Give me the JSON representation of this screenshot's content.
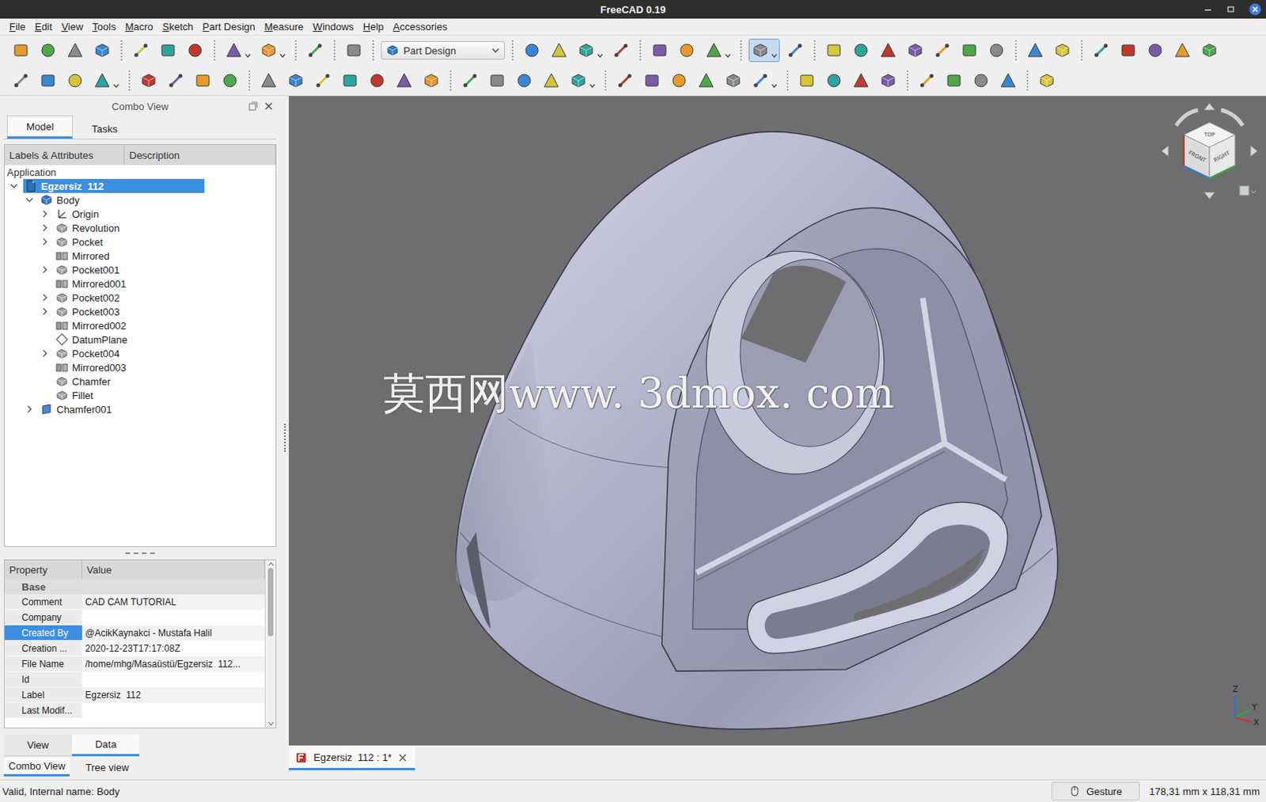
{
  "window": {
    "title": "FreeCAD 0.19"
  },
  "menu": [
    "File",
    "Edit",
    "View",
    "Tools",
    "Macro",
    "Sketch",
    "Part Design",
    "Measure",
    "Windows",
    "Help",
    "Accessories"
  ],
  "toolbars": [
    [
      {
        "kind": "button",
        "pressed": false,
        "dropdown": false
      },
      {
        "kind": "button",
        "pressed": false,
        "dropdown": false
      },
      {
        "kind": "button",
        "pressed": false,
        "dropdown": false
      },
      {
        "kind": "button",
        "pressed": false,
        "dropdown": false
      },
      {
        "kind": "separator"
      },
      {
        "kind": "button",
        "pressed": false,
        "dropdown": false
      },
      {
        "kind": "button",
        "pressed": false,
        "dropdown": false
      },
      {
        "kind": "button",
        "pressed": false,
        "dropdown": false
      },
      {
        "kind": "separator"
      },
      {
        "kind": "button",
        "pressed": false,
        "dropdown": true
      },
      {
        "kind": "button",
        "pressed": false,
        "dropdown": true
      },
      {
        "kind": "separator"
      },
      {
        "kind": "button",
        "pressed": false,
        "dropdown": false
      },
      {
        "kind": "separator"
      },
      {
        "kind": "button",
        "pressed": false,
        "dropdown": false
      },
      {
        "kind": "separator"
      },
      {
        "kind": "combo",
        "label": "Part Design"
      },
      {
        "kind": "separator"
      },
      {
        "kind": "button",
        "pressed": false,
        "dropdown": false
      },
      {
        "kind": "button",
        "pressed": false,
        "dropdown": false
      },
      {
        "kind": "button",
        "pressed": false,
        "dropdown": true
      },
      {
        "kind": "button",
        "pressed": false,
        "dropdown": false
      },
      {
        "kind": "separator"
      },
      {
        "kind": "button",
        "pressed": false,
        "dropdown": false
      },
      {
        "kind": "button",
        "pressed": false,
        "dropdown": false
      },
      {
        "kind": "button",
        "pressed": false,
        "dropdown": true
      },
      {
        "kind": "separator"
      },
      {
        "kind": "button",
        "pressed": true,
        "dropdown": true
      },
      {
        "kind": "button",
        "pressed": false,
        "dropdown": false
      },
      {
        "kind": "separator"
      },
      {
        "kind": "button",
        "pressed": false,
        "dropdown": false
      },
      {
        "kind": "button",
        "pressed": false,
        "dropdown": false
      },
      {
        "kind": "button",
        "pressed": false,
        "dropdown": false
      },
      {
        "kind": "button",
        "pressed": false,
        "dropdown": false
      },
      {
        "kind": "button",
        "pressed": false,
        "dropdown": false
      },
      {
        "kind": "button",
        "pressed": false,
        "dropdown": false
      },
      {
        "kind": "button",
        "pressed": false,
        "dropdown": false
      },
      {
        "kind": "separator"
      },
      {
        "kind": "button",
        "pressed": false,
        "dropdown": false
      },
      {
        "kind": "button",
        "pressed": false,
        "dropdown": false
      },
      {
        "kind": "separator"
      },
      {
        "kind": "button",
        "pressed": false,
        "dropdown": false
      },
      {
        "kind": "button",
        "pressed": false,
        "dropdown": false
      },
      {
        "kind": "button",
        "pressed": false,
        "dropdown": false
      },
      {
        "kind": "button",
        "pressed": false,
        "dropdown": false
      },
      {
        "kind": "button",
        "pressed": false,
        "dropdown": false
      }
    ],
    [
      {
        "kind": "button",
        "pressed": false,
        "dropdown": false
      },
      {
        "kind": "button",
        "pressed": false,
        "dropdown": false
      },
      {
        "kind": "button",
        "pressed": false,
        "dropdown": false
      },
      {
        "kind": "button",
        "pressed": false,
        "dropdown": true
      },
      {
        "kind": "separator"
      },
      {
        "kind": "button",
        "pressed": false,
        "dropdown": false
      },
      {
        "kind": "button",
        "pressed": false,
        "dropdown": false
      },
      {
        "kind": "button",
        "pressed": false,
        "dropdown": false
      },
      {
        "kind": "button",
        "pressed": false,
        "dropdown": false
      },
      {
        "kind": "separator"
      },
      {
        "kind": "button",
        "pressed": false,
        "dropdown": false
      },
      {
        "kind": "button",
        "pressed": false,
        "dropdown": false
      },
      {
        "kind": "button",
        "pressed": false,
        "dropdown": false
      },
      {
        "kind": "button",
        "pressed": false,
        "dropdown": false
      },
      {
        "kind": "button",
        "pressed": false,
        "dropdown": false
      },
      {
        "kind": "button",
        "pressed": false,
        "dropdown": false
      },
      {
        "kind": "button",
        "pressed": false,
        "dropdown": false
      },
      {
        "kind": "separator"
      },
      {
        "kind": "button",
        "pressed": false,
        "dropdown": false
      },
      {
        "kind": "button",
        "pressed": false,
        "dropdown": false
      },
      {
        "kind": "button",
        "pressed": false,
        "dropdown": false
      },
      {
        "kind": "button",
        "pressed": false,
        "dropdown": false
      },
      {
        "kind": "button",
        "pressed": false,
        "dropdown": true
      },
      {
        "kind": "separator"
      },
      {
        "kind": "button",
        "pressed": false,
        "dropdown": false
      },
      {
        "kind": "button",
        "pressed": false,
        "dropdown": false
      },
      {
        "kind": "button",
        "pressed": false,
        "dropdown": false
      },
      {
        "kind": "button",
        "pressed": false,
        "dropdown": false
      },
      {
        "kind": "button",
        "pressed": false,
        "dropdown": false
      },
      {
        "kind": "button",
        "pressed": false,
        "dropdown": true
      },
      {
        "kind": "separator"
      },
      {
        "kind": "button",
        "pressed": false,
        "dropdown": false
      },
      {
        "kind": "button",
        "pressed": false,
        "dropdown": false
      },
      {
        "kind": "button",
        "pressed": false,
        "dropdown": false
      },
      {
        "kind": "button",
        "pressed": false,
        "dropdown": false
      },
      {
        "kind": "separator"
      },
      {
        "kind": "button",
        "pressed": false,
        "dropdown": false
      },
      {
        "kind": "button",
        "pressed": false,
        "dropdown": false
      },
      {
        "kind": "button",
        "pressed": false,
        "dropdown": false
      },
      {
        "kind": "button",
        "pressed": false,
        "dropdown": false
      },
      {
        "kind": "separator"
      },
      {
        "kind": "button",
        "pressed": false,
        "dropdown": false
      }
    ]
  ],
  "combo_view": {
    "title": "Combo View",
    "tabs": [
      {
        "label": "Model",
        "selected": true
      },
      {
        "label": "Tasks",
        "selected": false
      }
    ]
  },
  "tree": {
    "columns": [
      "Labels & Attributes",
      "Description"
    ],
    "root": "Application",
    "items": [
      {
        "label": "Egzersiz  112",
        "depth": 0,
        "kind": "document",
        "expandable": true,
        "expanded": true,
        "selected": true
      },
      {
        "label": "Body",
        "depth": 1,
        "kind": "body",
        "expandable": true,
        "expanded": true,
        "selected": false
      },
      {
        "label": "Origin",
        "depth": 2,
        "kind": "origin",
        "expandable": true,
        "expanded": false,
        "selected": false
      },
      {
        "label": "Revolution",
        "depth": 2,
        "kind": "feature",
        "expandable": true,
        "expanded": false,
        "selected": false
      },
      {
        "label": "Pocket",
        "depth": 2,
        "kind": "feature",
        "expandable": true,
        "expanded": false,
        "selected": false
      },
      {
        "label": "Mirrored",
        "depth": 2,
        "kind": "pattern",
        "expandable": false,
        "expanded": false,
        "selected": false
      },
      {
        "label": "Pocket001",
        "depth": 2,
        "kind": "feature",
        "expandable": true,
        "expanded": false,
        "selected": false
      },
      {
        "label": "Mirrored001",
        "depth": 2,
        "kind": "pattern",
        "expandable": false,
        "expanded": false,
        "selected": false
      },
      {
        "label": "Pocket002",
        "depth": 2,
        "kind": "feature",
        "expandable": true,
        "expanded": false,
        "selected": false
      },
      {
        "label": "Pocket003",
        "depth": 2,
        "kind": "feature",
        "expandable": true,
        "expanded": false,
        "selected": false
      },
      {
        "label": "Mirrored002",
        "depth": 2,
        "kind": "pattern",
        "expandable": false,
        "expanded": false,
        "selected": false
      },
      {
        "label": "DatumPlane",
        "depth": 2,
        "kind": "datum",
        "expandable": false,
        "expanded": false,
        "selected": false
      },
      {
        "label": "Pocket004",
        "depth": 2,
        "kind": "feature",
        "expandable": true,
        "expanded": false,
        "selected": false
      },
      {
        "label": "Mirrored003",
        "depth": 2,
        "kind": "pattern",
        "expandable": false,
        "expanded": false,
        "selected": false
      },
      {
        "label": "Chamfer",
        "depth": 2,
        "kind": "feature",
        "expandable": false,
        "expanded": false,
        "selected": false
      },
      {
        "label": "Fillet",
        "depth": 2,
        "kind": "feature",
        "expandable": false,
        "expanded": false,
        "selected": false
      },
      {
        "label": "Chamfer001",
        "depth": 1,
        "kind": "part",
        "expandable": true,
        "expanded": false,
        "selected": false
      }
    ]
  },
  "properties": {
    "columns": [
      "Property",
      "Value"
    ],
    "group": "Base",
    "rows": [
      {
        "name": "Comment",
        "value": "CAD CAM TUTORIAL",
        "selected": false
      },
      {
        "name": "Company",
        "value": "",
        "selected": false
      },
      {
        "name": "Created By",
        "value": "@AcikKaynakci - Mustafa Halil",
        "selected": true
      },
      {
        "name": "Creation ...",
        "value": "2020-12-23T17:17:08Z",
        "selected": false
      },
      {
        "name": "File Name",
        "value": "/home/mhg/Masaüstü/Egzersiz  112...",
        "selected": false
      },
      {
        "name": "Id",
        "value": "",
        "selected": false
      },
      {
        "name": "Label",
        "value": "Egzersiz  112",
        "selected": false
      },
      {
        "name": "Last Modif...",
        "value": "",
        "selected": false
      }
    ],
    "scrollbar": {
      "level": 0.45
    }
  },
  "property_tabs": [
    {
      "label": "View",
      "selected": false
    },
    {
      "label": "Data",
      "selected": true
    }
  ],
  "panel_tabs": [
    {
      "label": "Combo View",
      "selected": true
    },
    {
      "label": "Tree view",
      "selected": false
    }
  ],
  "viewport": {
    "watermark": "莫西网www. 3dmox. com",
    "nav_cube": {
      "faces": [
        "TOP",
        "FRONT",
        "RIGHT"
      ]
    },
    "axes": [
      "Z",
      "Y",
      "X"
    ]
  },
  "document_tabs": [
    {
      "label": "Egzersiz  112 : 1*",
      "selected": true
    }
  ],
  "status_bar": {
    "message": "Valid, Internal name: Body",
    "navigation": "Gesture",
    "dimensions": "178,31 mm x 118,31 mm"
  }
}
